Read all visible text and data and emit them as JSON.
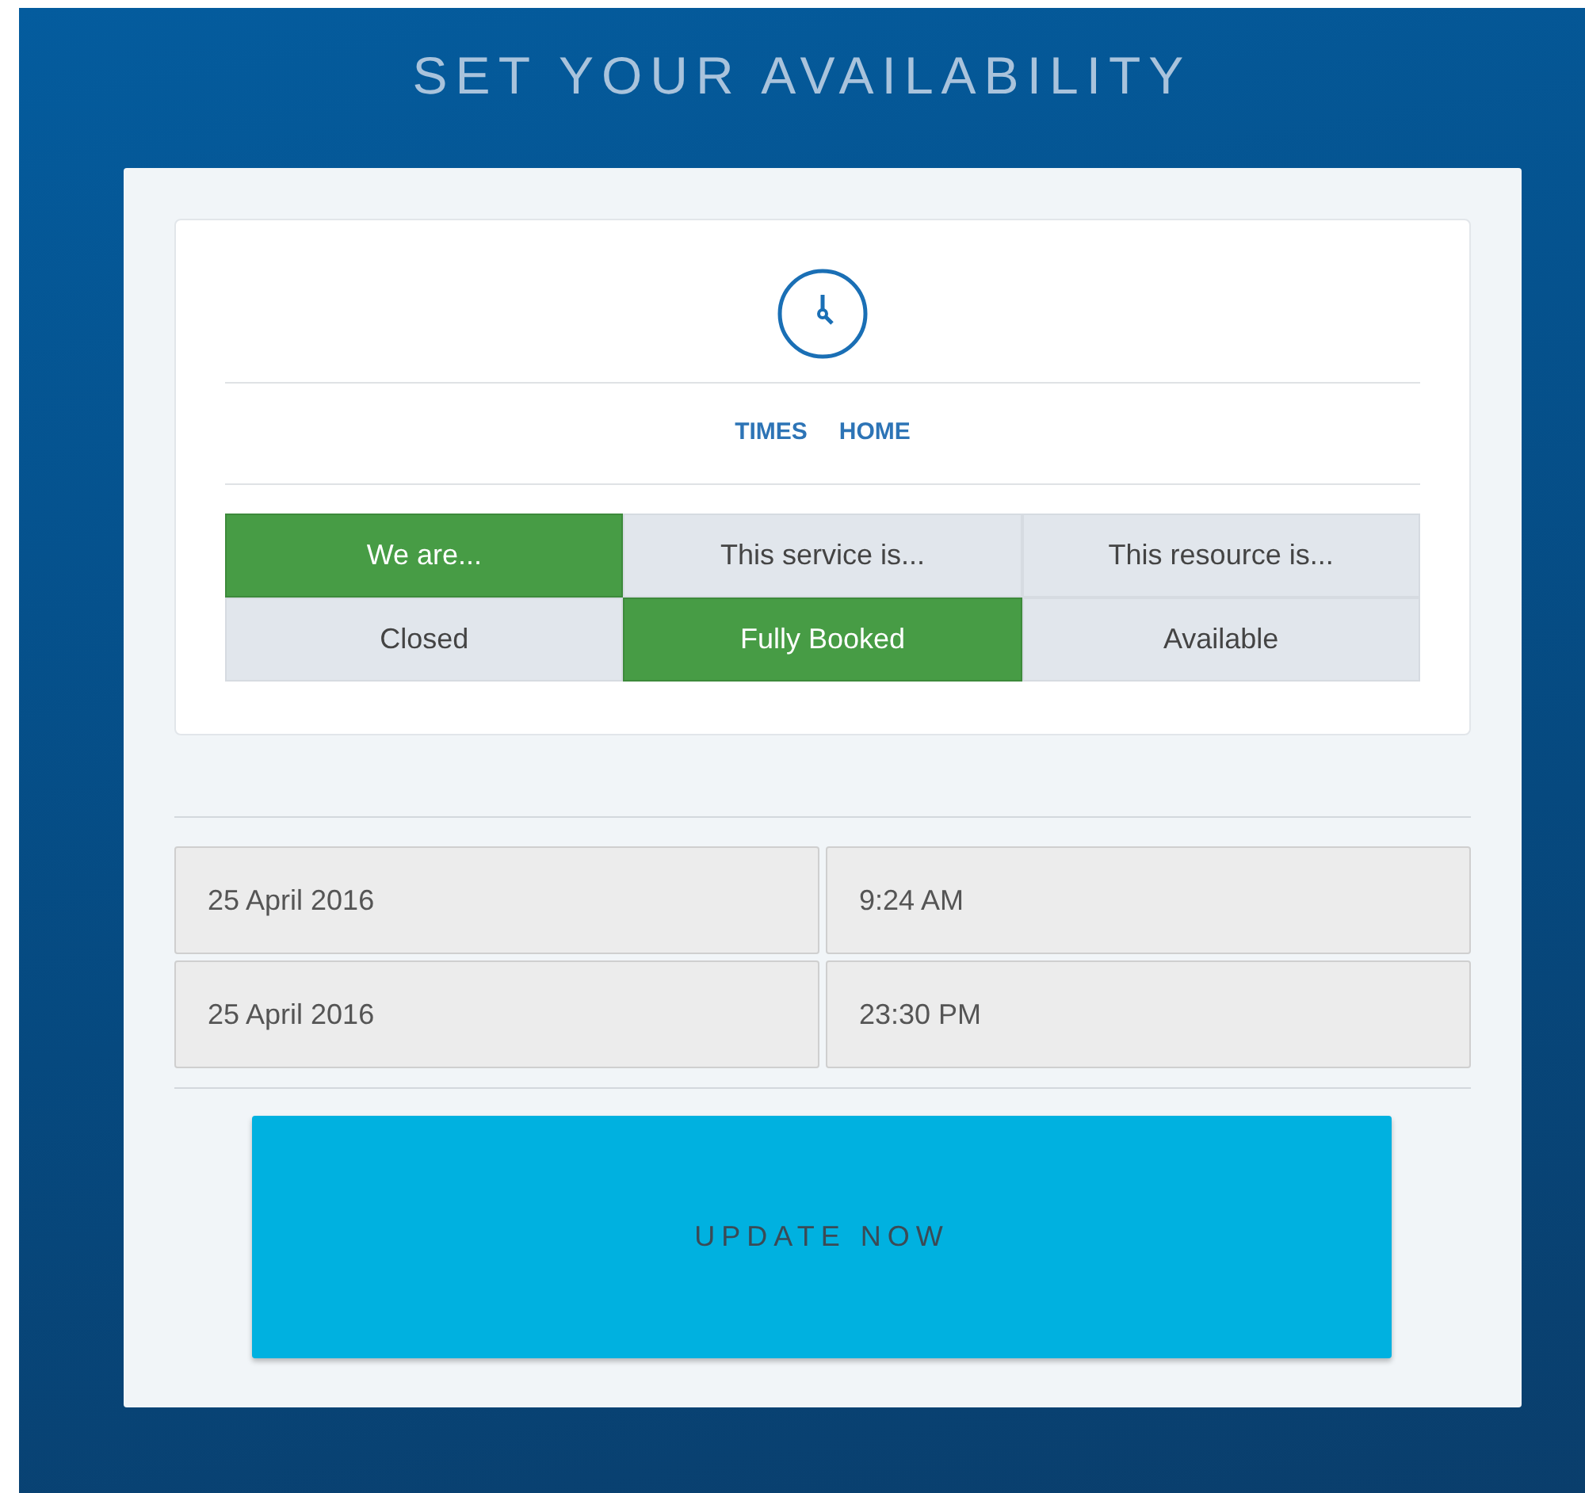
{
  "title": "SET YOUR AVAILABILITY",
  "nav_links": [
    "TIMES",
    "HOME"
  ],
  "toggle_rows": [
    [
      {
        "label": "We are...",
        "selected": true
      },
      {
        "label": "This service is...",
        "selected": false
      },
      {
        "label": "This resource is...",
        "selected": false
      }
    ],
    [
      {
        "label": "Closed",
        "selected": false
      },
      {
        "label": "Fully Booked",
        "selected": true
      },
      {
        "label": "Available",
        "selected": false
      }
    ]
  ],
  "time_rows": [
    {
      "date": "25 April 2016",
      "time": "9:24 AM"
    },
    {
      "date": "25 April 2016",
      "time": "23:30 PM"
    }
  ],
  "button": "UPDATE NOW"
}
